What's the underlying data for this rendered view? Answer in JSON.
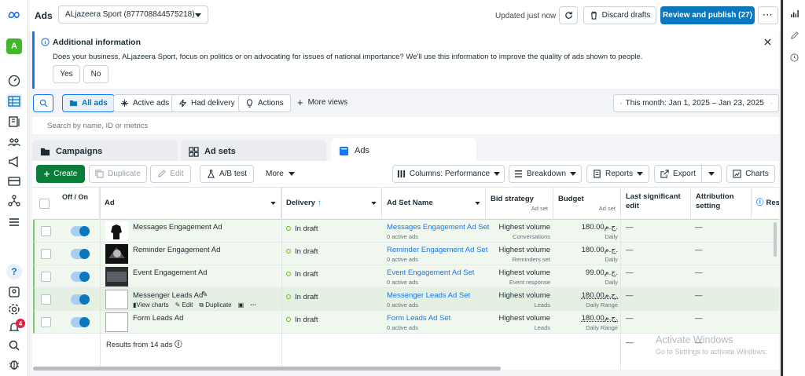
{
  "app": {
    "title": "Ads",
    "account": "ALjazeera Sport (877708844575218)"
  },
  "header": {
    "updated": "Updated just now",
    "discard": "Discard drafts",
    "publish": "Review and publish (27)"
  },
  "leftnav": {
    "avatar": "A",
    "badge": "4",
    "help": "?"
  },
  "banner": {
    "title": "Additional information",
    "text": "Does your business, ALjazeera Sport, focus on politics or on advocating for issues of national importance? We'll use this information to improve the quality of ads shown to people.",
    "yes": "Yes",
    "no": "No"
  },
  "filters": {
    "all_ads": "All ads",
    "active_ads": "Active ads",
    "had_delivery": "Had delivery",
    "actions": "Actions",
    "more_views": "More views",
    "date": "This month: Jan 1, 2025 – Jan 23, 2025"
  },
  "search": {
    "placeholder": "Search by name, ID or metrics"
  },
  "tabs": {
    "campaigns": "Campaigns",
    "adsets": "Ad sets",
    "ads": "Ads"
  },
  "toolbar": {
    "create": "Create",
    "duplicate": "Duplicate",
    "edit": "Edit",
    "abtest": "A/B test",
    "more": "More",
    "columns": "Columns: Performance",
    "breakdown": "Breakdown",
    "reports": "Reports",
    "export": "Export",
    "charts": "Charts"
  },
  "table": {
    "headers": {
      "offon": "Off / On",
      "ad": "Ad",
      "delivery": "Delivery",
      "adset": "Ad Set Name",
      "bid": "Bid strategy",
      "bid_sub": "Ad set",
      "budget": "Budget",
      "budget_sub": "Ad set",
      "lastedit": "Last significant edit",
      "attribution": "Attribution setting",
      "res": "Res"
    },
    "rows": [
      {
        "ad": "Messages Engagement Ad",
        "delivery": "In draft",
        "adset": "Messages Engagement Ad Set",
        "adset_sub": "0 active ads",
        "bid": "Highest volume",
        "bid_sub": "Conversations",
        "budget": "180.00ج.م.",
        "budget_sub": "Daily",
        "last": "—",
        "attr": "—"
      },
      {
        "ad": "Reminder Engagement Ad",
        "delivery": "In draft",
        "adset": "Reminder Engagement Ad Set",
        "adset_sub": "0 active ads",
        "bid": "Highest volume",
        "bid_sub": "Reminders set",
        "budget": "180.00ج.م.",
        "budget_sub": "Daily",
        "last": "—",
        "attr": "—"
      },
      {
        "ad": "Event Engagement Ad",
        "delivery": "In draft",
        "adset": "Event Engagement Ad Set",
        "adset_sub": "0 active ads",
        "bid": "Highest volume",
        "bid_sub": "Event response",
        "budget": "99.00ج.م.",
        "budget_sub": "Daily",
        "last": "—",
        "attr": "—"
      },
      {
        "ad": "Messenger Leads Ad",
        "delivery": "In draft",
        "adset": "Messenger Leads Ad Set",
        "adset_sub": "0 active ads",
        "bid": "Highest volume",
        "bid_sub": "Leads",
        "budget": "180.00ج.م.",
        "budget_sub": "Daily Range",
        "last": "—",
        "attr": "—"
      },
      {
        "ad": "Form Leads Ad",
        "delivery": "In draft",
        "adset": "Form Leads Ad Set",
        "adset_sub": "0 active ads",
        "bid": "Highest volume",
        "bid_sub": "Leads",
        "budget": "180.00ج.م.",
        "budget_sub": "Daily Range",
        "last": "—",
        "attr": "—"
      }
    ],
    "hover_actions": {
      "view": "View charts",
      "edit": "Edit",
      "duplicate": "Duplicate"
    },
    "results": "Results from 14 ads",
    "footer_dashes": [
      "—",
      "—"
    ]
  },
  "watermark": {
    "title": "Activate Windows",
    "sub": "Go to Settings to activate Windows."
  }
}
